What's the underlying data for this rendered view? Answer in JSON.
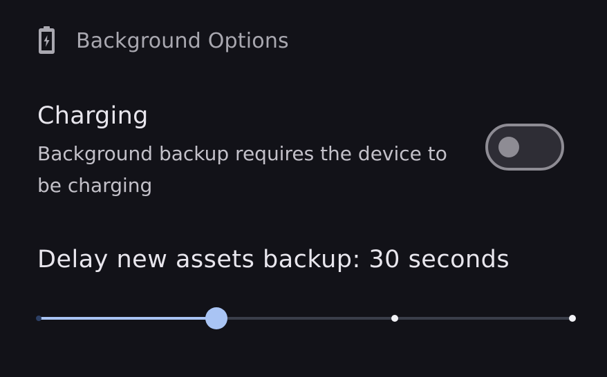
{
  "section": {
    "title": "Background Options",
    "icon": "battery-charging-icon"
  },
  "charging_setting": {
    "title": "Charging",
    "description": "Background backup requires the device to be charging",
    "toggle_on": false
  },
  "delay_setting": {
    "label": "Delay new assets backup: 30 seconds",
    "slider": {
      "steps": 4,
      "current_step_index": 1
    }
  },
  "colors": {
    "background": "#121218",
    "accent": "#a9c4f4",
    "toggle_off": "#8e8c94",
    "muted_text": "#a9a8b0"
  }
}
